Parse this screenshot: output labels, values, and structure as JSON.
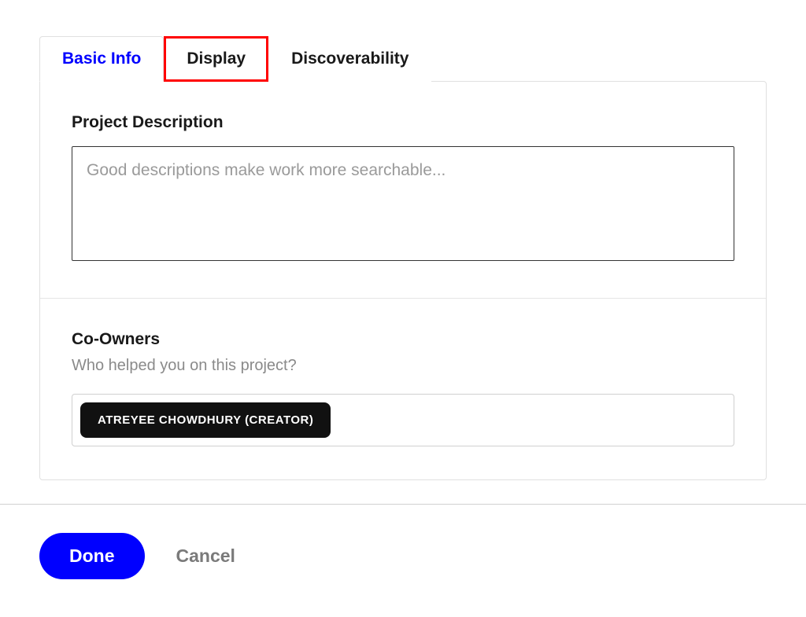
{
  "tabs": {
    "basic_info": "Basic Info",
    "display": "Display",
    "discoverability": "Discoverability"
  },
  "description": {
    "label": "Project Description",
    "placeholder": "Good descriptions make work more searchable...",
    "value": ""
  },
  "coowners": {
    "label": "Co-Owners",
    "subtitle": "Who helped you on this project?",
    "chips": [
      "ATREYEE CHOWDHURY (CREATOR)"
    ]
  },
  "actions": {
    "done": "Done",
    "cancel": "Cancel"
  }
}
